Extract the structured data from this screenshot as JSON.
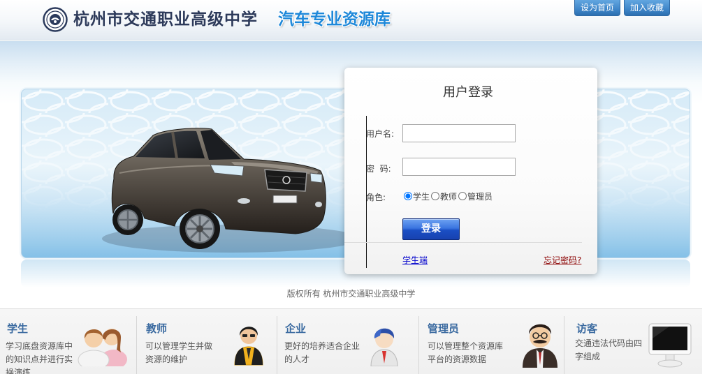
{
  "header": {
    "school_name": "杭州市交通职业高级中学",
    "subtitle": "汽车专业资源库",
    "set_home_label": "设为首页",
    "bookmark_label": "加入收藏",
    "logo_icon": "school-emblem-icon"
  },
  "login": {
    "title": "用户登录",
    "username_label": "用户名:",
    "username_value": "",
    "password_label": "密  码:",
    "password_value": "",
    "role_label": "角色:",
    "role_options": [
      {
        "label": "学生",
        "checked": true
      },
      {
        "label": "教师",
        "checked": false
      },
      {
        "label": "管理员",
        "checked": false
      }
    ],
    "submit_label": "登录",
    "student_link": "学生端",
    "forgot_link": "忘记密码?"
  },
  "copyright": "版权所有 杭州市交通职业高级中学",
  "user_types": [
    {
      "title": "学生",
      "description": "学习底盘资源库中的知识点并进行实操演练",
      "icon": "students-icon"
    },
    {
      "title": "教师",
      "description": "可以管理学生并做资源的维护",
      "icon": "teacher-icon"
    },
    {
      "title": "企业",
      "description": "更好的培养适合企业的人才",
      "icon": "enterprise-person-icon"
    },
    {
      "title": "管理员",
      "description": "可以管理整个资源库平台的资源数据",
      "icon": "administrator-icon"
    },
    {
      "title": "访客",
      "description": "交通违法代码由四字组成",
      "icon": "monitor-icon"
    }
  ],
  "colors": {
    "school_name": "#2d3a5a",
    "subtitle": "#1e88d9",
    "top_button": "#3f86c9",
    "login_button": "#1a4fc4",
    "user_type_title": "#3a6aa0",
    "student_link": "#0000cc",
    "forgot_link": "#8b0000"
  }
}
